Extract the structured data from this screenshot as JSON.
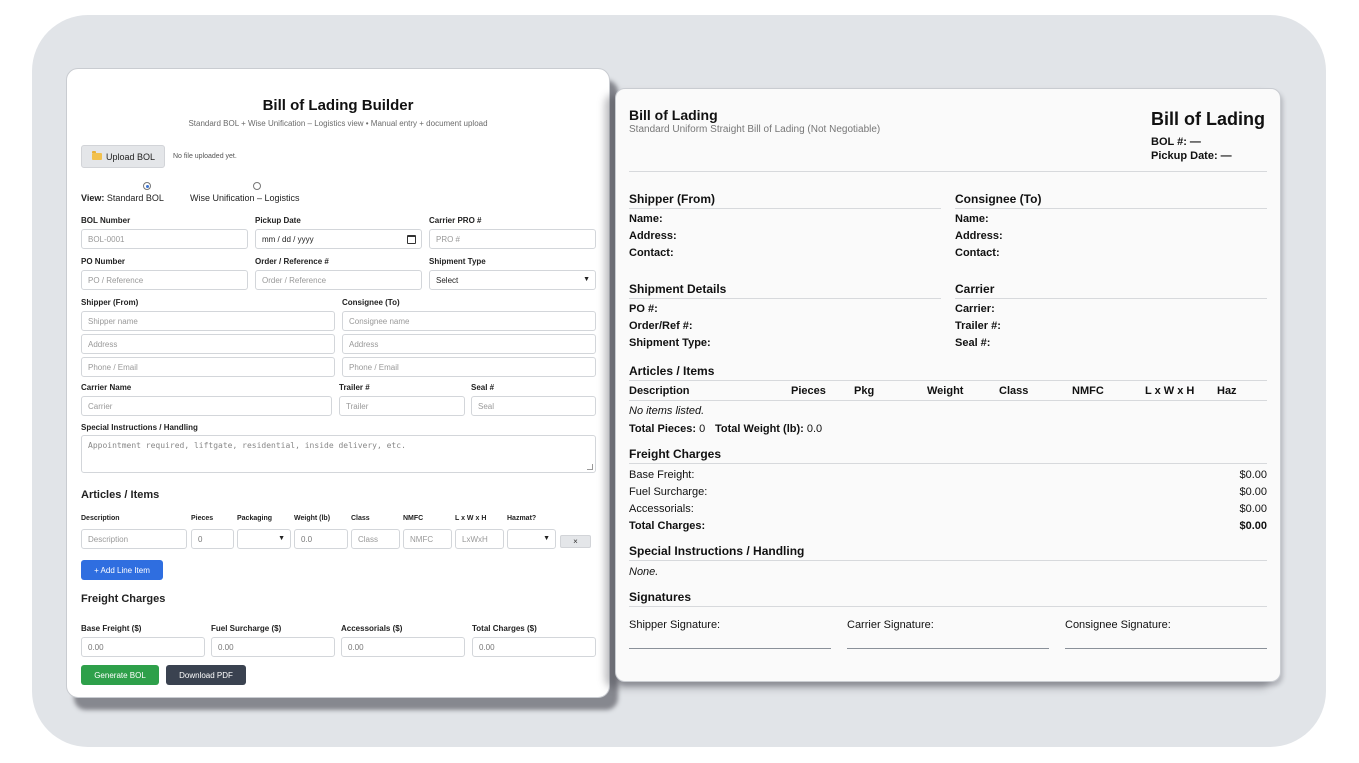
{
  "builder": {
    "title": "Bill of Lading Builder",
    "subtitle": "Standard BOL + Wise Unification – Logistics view • Manual entry + document upload",
    "upload_label": "Upload BOL",
    "upload_status": "No file uploaded yet.",
    "view": {
      "label": "View:",
      "options": [
        "Standard BOL",
        "Wise Unification – Logistics"
      ],
      "selected": "Standard BOL"
    },
    "fields": {
      "bol_number": {
        "label": "BOL Number",
        "placeholder": "BOL-0001"
      },
      "pickup_date": {
        "label": "Pickup Date",
        "value": "mm / dd / yyyy"
      },
      "carrier_pro": {
        "label": "Carrier PRO #",
        "placeholder": "PRO #"
      },
      "po_number": {
        "label": "PO Number",
        "placeholder": "PO / Reference"
      },
      "order_ref": {
        "label": "Order / Reference #",
        "placeholder": "Order / Reference"
      },
      "shipment_type": {
        "label": "Shipment Type",
        "value": "Select"
      },
      "shipper": {
        "label": "Shipper (From)",
        "name_ph": "Shipper name",
        "address_ph": "Address",
        "contact_ph": "Phone / Email"
      },
      "consignee": {
        "label": "Consignee (To)",
        "name_ph": "Consignee name",
        "address_ph": "Address",
        "contact_ph": "Phone / Email"
      },
      "carrier_name": {
        "label": "Carrier Name",
        "placeholder": "Carrier"
      },
      "trailer": {
        "label": "Trailer #",
        "placeholder": "Trailer"
      },
      "seal": {
        "label": "Seal #",
        "placeholder": "Seal"
      },
      "special": {
        "label": "Special Instructions / Handling",
        "placeholder": "Appointment required, liftgate, residential, inside delivery, etc."
      }
    },
    "articles": {
      "title": "Articles / Items",
      "columns": [
        "Description",
        "Pieces",
        "Packaging",
        "Weight (lb)",
        "Class",
        "NMFC",
        "L x W x H",
        "Hazmat?"
      ],
      "row": {
        "description": "Description",
        "pieces": "0",
        "weight": "0.0",
        "class": "Class",
        "nmfc": "NMFC",
        "dims": "LxWxH",
        "remove": "×"
      },
      "add_label": "+ Add Line Item"
    },
    "charges": {
      "title": "Freight Charges",
      "base": {
        "label": "Base Freight ($)",
        "value": "0.00"
      },
      "fuel": {
        "label": "Fuel Surcharge ($)",
        "value": "0.00"
      },
      "accessorials": {
        "label": "Accessorials ($)",
        "value": "0.00"
      },
      "total": {
        "label": "Total Charges ($)",
        "value": "0.00"
      }
    },
    "generate_label": "Generate BOL",
    "download_label": "Download PDF"
  },
  "preview": {
    "title": "Bill of Lading",
    "subtitle": "Standard Uniform Straight Bill of Lading (Not Negotiable)",
    "big_title": "Bill of Lading",
    "bol_line": "BOL #: —",
    "pickup_line": "Pickup Date: —",
    "shipper": {
      "title": "Shipper (From)",
      "name": "Name:",
      "address": "Address:",
      "contact": "Contact:"
    },
    "consignee": {
      "title": "Consignee (To)",
      "name": "Name:",
      "address": "Address:",
      "contact": "Contact:"
    },
    "shipment": {
      "title": "Shipment Details",
      "po": "PO #:",
      "order": "Order/Ref #:",
      "type": "Shipment Type:"
    },
    "carrier": {
      "title": "Carrier",
      "carrier": "Carrier:",
      "trailer": "Trailer #:",
      "seal": "Seal #:"
    },
    "articles": {
      "title": "Articles / Items",
      "columns": [
        "Description",
        "Pieces",
        "Pkg",
        "Weight",
        "Class",
        "NMFC",
        "L x W x H",
        "Haz"
      ],
      "empty": "No items listed.",
      "total_pieces_label": "Total Pieces:",
      "total_pieces": "0",
      "total_weight_label": "Total Weight (lb):",
      "total_weight": "0.0"
    },
    "charges": {
      "title": "Freight Charges",
      "rows": [
        {
          "label": "Base Freight:",
          "value": "$0.00"
        },
        {
          "label": "Fuel Surcharge:",
          "value": "$0.00"
        },
        {
          "label": "Accessorials:",
          "value": "$0.00"
        },
        {
          "label": "Total Charges:",
          "value": "$0.00"
        }
      ]
    },
    "special": {
      "title": "Special Instructions / Handling",
      "value": "None."
    },
    "signatures": {
      "title": "Signatures",
      "shipper": "Shipper Signature:",
      "carrier": "Carrier Signature:",
      "consignee": "Consignee Signature:"
    }
  }
}
